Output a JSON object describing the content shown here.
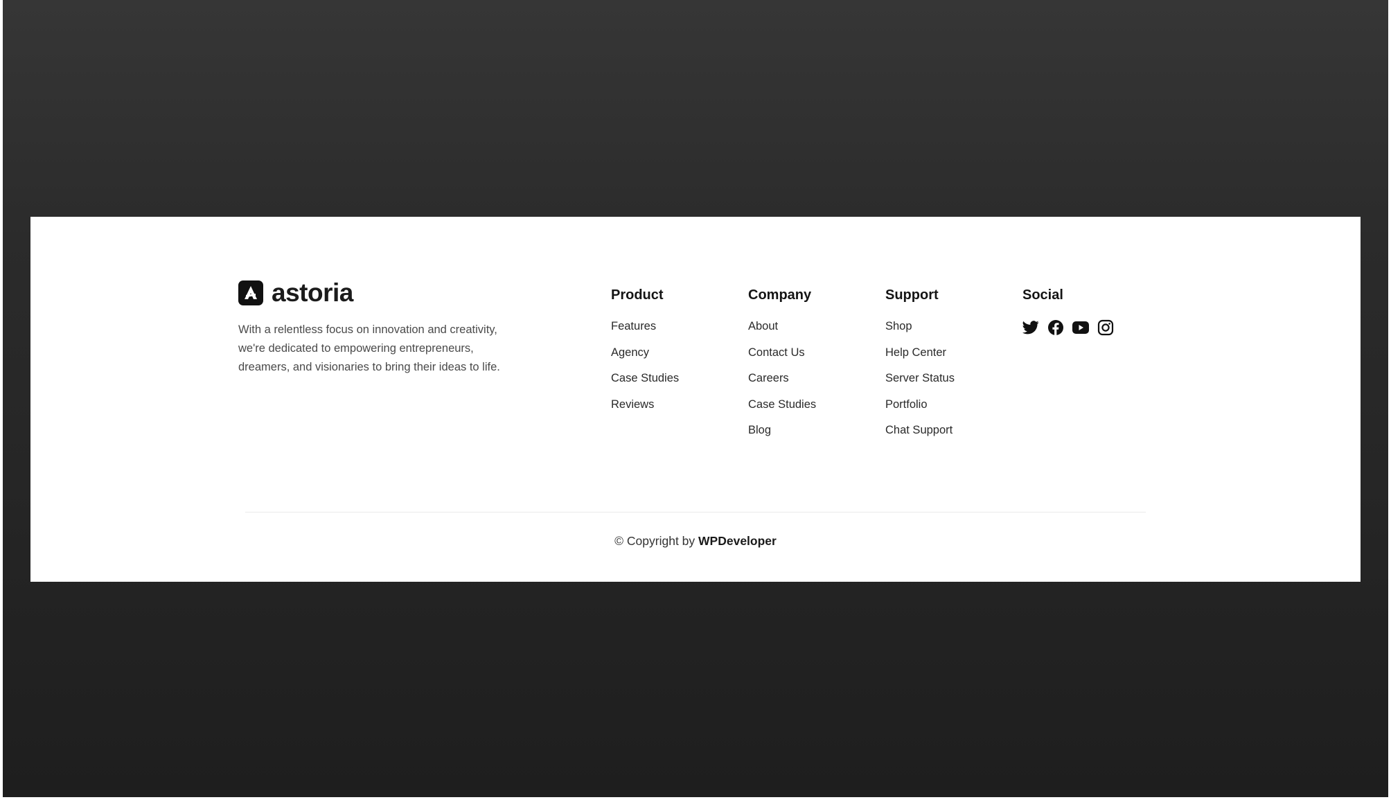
{
  "brand": {
    "name": "astoria",
    "description": "With a relentless focus on innovation and creativity, we're dedicated to empowering entrepreneurs, dreamers, and visionaries to bring their ideas to life."
  },
  "columns": {
    "product": {
      "title": "Product",
      "items": [
        "Features",
        "Agency",
        "Case Studies",
        "Reviews"
      ]
    },
    "company": {
      "title": "Company",
      "items": [
        "About",
        "Contact Us",
        "Careers",
        "Case Studies",
        "Blog"
      ]
    },
    "support": {
      "title": "Support",
      "items": [
        "Shop",
        "Help Center",
        "Server Status",
        "Portfolio",
        "Chat Support"
      ]
    },
    "social": {
      "title": "Social",
      "icons": [
        "twitter-icon",
        "facebook-icon",
        "youtube-icon",
        "instagram-icon"
      ]
    }
  },
  "copyright": {
    "prefix": "© Copyright by",
    "owner": "WPDeveloper"
  },
  "colors": {
    "backdrop": "#2b2b2b",
    "card": "#ffffff",
    "text": "#141414"
  }
}
